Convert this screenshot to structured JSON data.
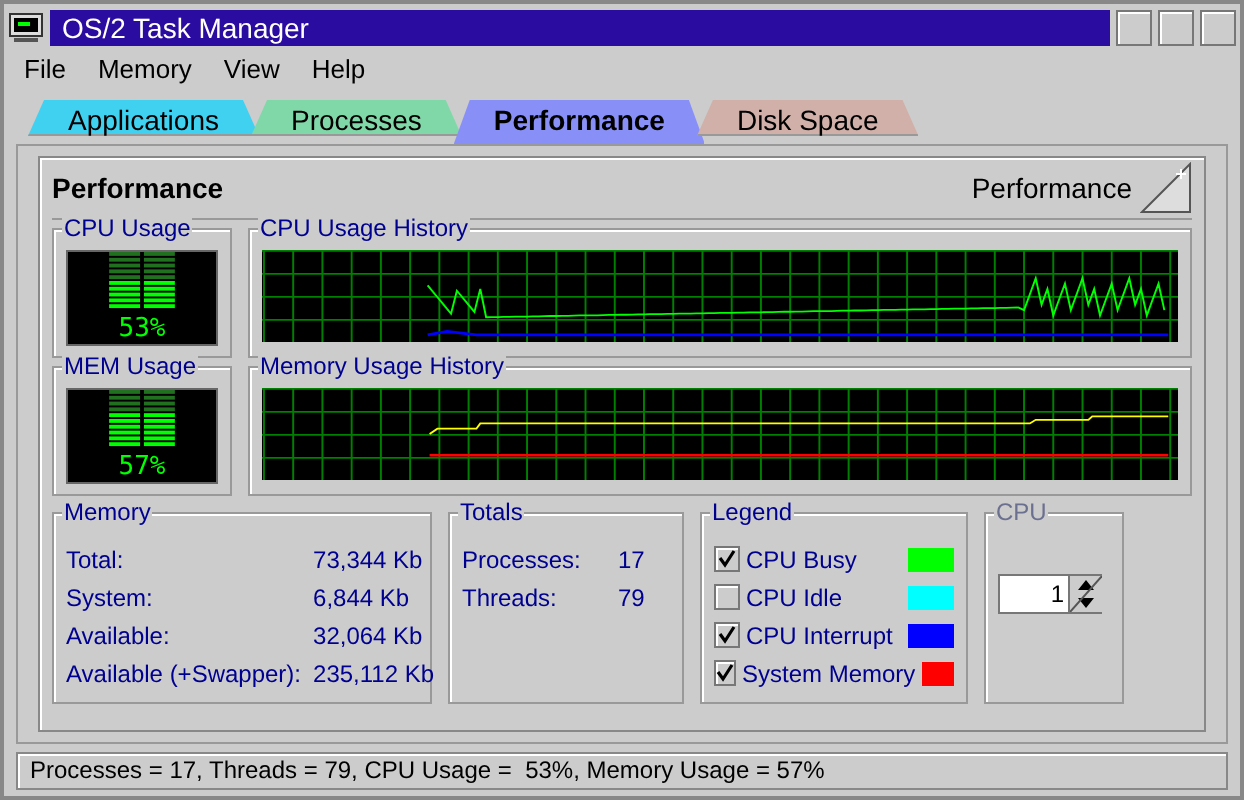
{
  "window": {
    "title": "OS/2 Task Manager"
  },
  "menu": [
    "File",
    "Memory",
    "View",
    "Help"
  ],
  "tabs": [
    {
      "label": "Applications",
      "selected": false,
      "color": "#40d0f0"
    },
    {
      "label": "Processes",
      "selected": false,
      "color": "#80d8a8"
    },
    {
      "label": "Performance",
      "selected": true,
      "color": "#8890f8"
    },
    {
      "label": "Disk Space",
      "selected": false,
      "color": "#d0b0a8"
    }
  ],
  "page": {
    "heading": "Performance",
    "corner_label": "Performance"
  },
  "cpu_usage": {
    "title": "CPU Usage",
    "reading": "53%",
    "level": 0.53
  },
  "cpu_history": {
    "title": "CPU Usage History"
  },
  "mem_usage": {
    "title": "MEM Usage",
    "reading": "57%",
    "level": 0.57
  },
  "mem_history": {
    "title": "Memory Usage History"
  },
  "memory": {
    "title": "Memory",
    "rows": [
      {
        "label": "Total:",
        "value": "73,344 Kb"
      },
      {
        "label": "System:",
        "value": "6,844 Kb"
      },
      {
        "label": "Available:",
        "value": "32,064 Kb"
      },
      {
        "label": "Available (+Swapper):",
        "value": "235,112 Kb"
      }
    ]
  },
  "totals": {
    "title": "Totals",
    "rows": [
      {
        "label": "Processes:",
        "value": "17"
      },
      {
        "label": "Threads:",
        "value": "79"
      }
    ]
  },
  "legend": {
    "title": "Legend",
    "items": [
      {
        "label": "CPU Busy",
        "checked": true,
        "color": "#00ff00"
      },
      {
        "label": "CPU Idle",
        "checked": false,
        "color": "#00ffff"
      },
      {
        "label": "CPU Interrupt",
        "checked": true,
        "color": "#0000ff"
      },
      {
        "label": "System Memory",
        "checked": true,
        "color": "#ff0000"
      }
    ]
  },
  "cpu": {
    "title": "CPU",
    "disabled": true,
    "value": "1"
  },
  "status_bar": "Processes = 17, Threads = 79, CPU Usage =  53%, Memory Usage = 57%"
}
